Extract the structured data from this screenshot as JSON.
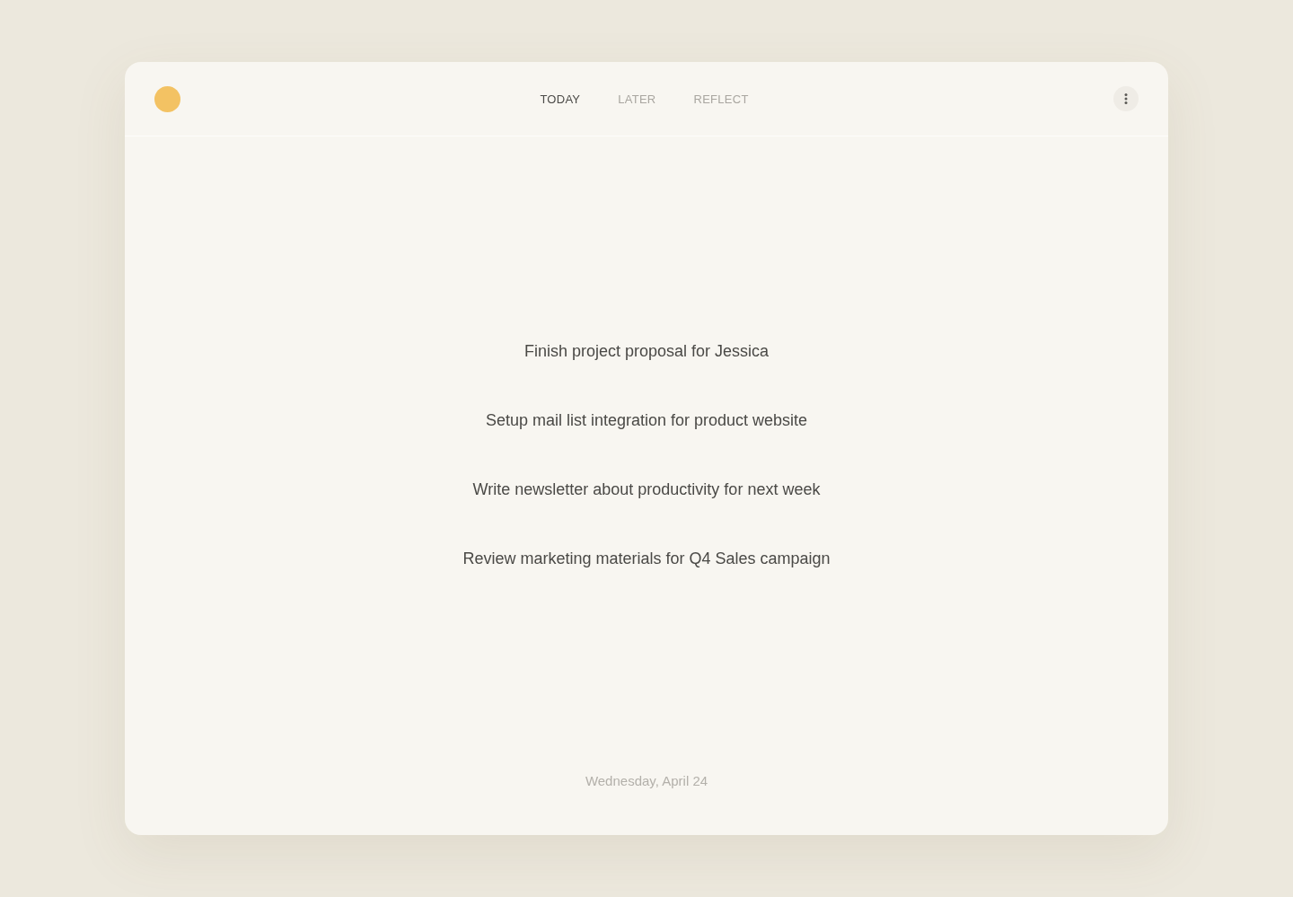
{
  "header": {
    "tabs": [
      {
        "label": "TODAY",
        "selected": true
      },
      {
        "label": "LATER",
        "selected": false
      },
      {
        "label": "REFLECT",
        "selected": false
      }
    ]
  },
  "tasks": [
    {
      "title": "Finish project proposal for Jessica"
    },
    {
      "title": "Setup mail list integration for product website"
    },
    {
      "title": "Write newsletter about productivity for next week"
    },
    {
      "title": "Review marketing materials for Q4 Sales campaign"
    }
  ],
  "footer": {
    "date": "Wednesday, April 24"
  }
}
